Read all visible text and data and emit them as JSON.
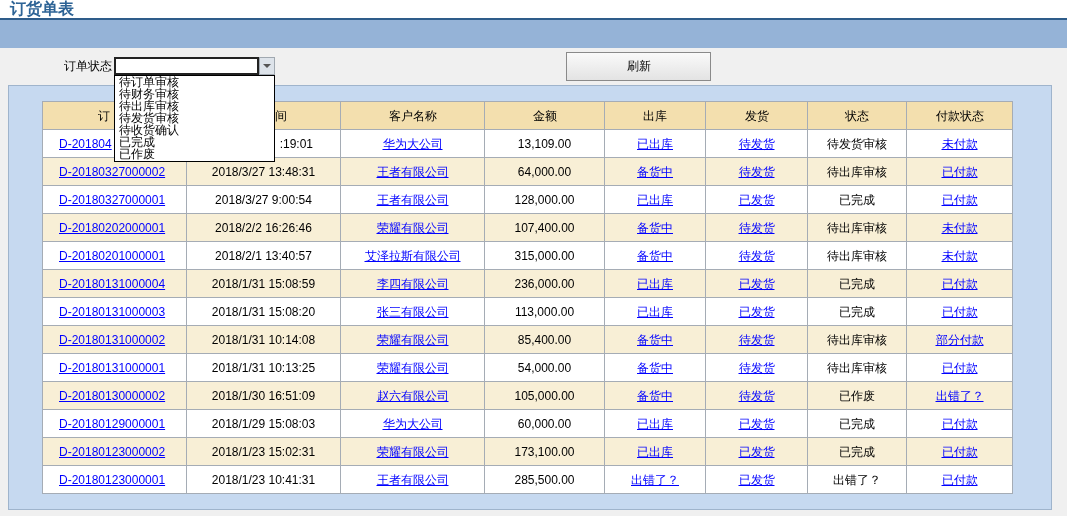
{
  "title": "订货单表",
  "filter": {
    "label": "订单状态",
    "expanded": true,
    "options": [
      "待订单审核",
      "待财务审核",
      "待出库审核",
      "待发货审核",
      "待收货确认",
      "已完成",
      "已作废"
    ]
  },
  "refresh_button": "刷新",
  "table": {
    "columns": [
      {
        "header": "订",
        "kind": "link"
      },
      {
        "header": "间",
        "kind": "text"
      },
      {
        "header": "客户名称",
        "kind": "link"
      },
      {
        "header": "金额",
        "kind": "text"
      },
      {
        "header": "出库",
        "kind": "link"
      },
      {
        "header": "发货",
        "kind": "link"
      },
      {
        "header": "状态",
        "kind": "text"
      },
      {
        "header": "付款状态",
        "kind": "link"
      }
    ],
    "rows": [
      [
        "D-201804",
        ":19:01",
        "华为大公司",
        "13,109.00",
        "已出库",
        "待发货",
        "待发货审核",
        "未付款"
      ],
      [
        "D-20180327000002",
        "2018/3/27 13:48:31",
        "王者有限公司",
        "64,000.00",
        "备货中",
        "待发货",
        "待出库审核",
        "已付款"
      ],
      [
        "D-20180327000001",
        "2018/3/27 9:00:54",
        "王者有限公司",
        "128,000.00",
        "已出库",
        "已发货",
        "已完成",
        "已付款"
      ],
      [
        "D-20180202000001",
        "2018/2/2 16:26:46",
        "荣耀有限公司",
        "107,400.00",
        "备货中",
        "待发货",
        "待出库审核",
        "未付款"
      ],
      [
        "D-20180201000001",
        "2018/2/1 13:40:57",
        "艾泽拉斯有限公司",
        "315,000.00",
        "备货中",
        "待发货",
        "待出库审核",
        "未付款"
      ],
      [
        "D-20180131000004",
        "2018/1/31 15:08:59",
        "李四有限公司",
        "236,000.00",
        "已出库",
        "已发货",
        "已完成",
        "已付款"
      ],
      [
        "D-20180131000003",
        "2018/1/31 15:08:20",
        "张三有限公司",
        "113,000.00",
        "已出库",
        "已发货",
        "已完成",
        "已付款"
      ],
      [
        "D-20180131000002",
        "2018/1/31 10:14:08",
        "荣耀有限公司",
        "85,400.00",
        "备货中",
        "待发货",
        "待出库审核",
        "部分付款"
      ],
      [
        "D-20180131000001",
        "2018/1/31 10:13:25",
        "荣耀有限公司",
        "54,000.00",
        "备货中",
        "待发货",
        "待出库审核",
        "已付款"
      ],
      [
        "D-20180130000002",
        "2018/1/30 16:51:09",
        "赵六有限公司",
        "105,000.00",
        "备货中",
        "待发货",
        "已作废",
        "出错了？"
      ],
      [
        "D-20180129000001",
        "2018/1/29 15:08:03",
        "华为大公司",
        "60,000.00",
        "已出库",
        "已发货",
        "已完成",
        "已付款"
      ],
      [
        "D-20180123000002",
        "2018/1/23 15:02:31",
        "荣耀有限公司",
        "173,100.00",
        "已出库",
        "已发货",
        "已完成",
        "已付款"
      ],
      [
        "D-20180123000001",
        "2018/1/23 10:41:31",
        "王者有限公司",
        "285,500.00",
        "出错了？",
        "已发货",
        "出错了？",
        "已付款"
      ]
    ]
  }
}
